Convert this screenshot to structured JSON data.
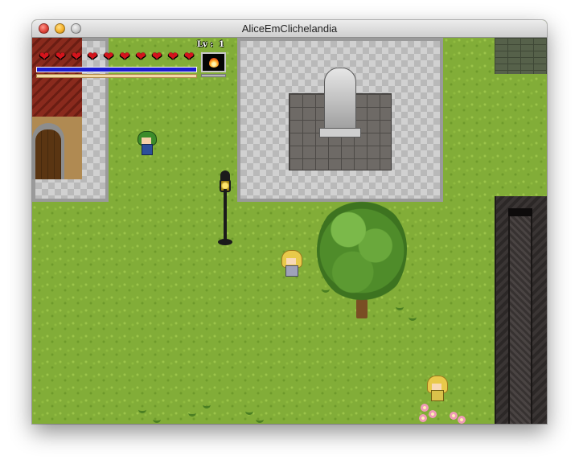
{
  "window": {
    "title": "AliceEmClichelandia"
  },
  "hud": {
    "hearts": [
      "❤",
      "❤",
      "❤",
      "❤",
      "❤",
      "❤",
      "❤",
      "❤",
      "❤",
      "❤"
    ],
    "level_text": "Lv :  1",
    "hp_fraction": 1.0,
    "exp_fraction": 0.0,
    "skill_icon": "fire-icon",
    "colors": {
      "heart": "#d4141c",
      "hp_bar": "#1b1bd0",
      "exp_bar": "#f2d9a6"
    }
  },
  "scene": {
    "colors": {
      "grass": "#82ad38",
      "plaza": "#b9b9b9",
      "roof": "#8a2a1d"
    }
  }
}
